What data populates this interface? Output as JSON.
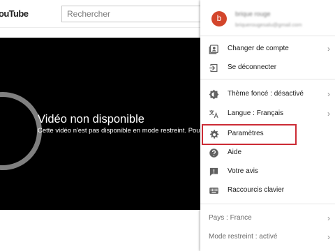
{
  "header": {
    "logo_text": "ouTube",
    "search_placeholder": "Rechercher"
  },
  "player": {
    "title": "Vidéo non disponible",
    "subtitle": "Cette vidéo n'est pas disponible en mode restreint. Pou"
  },
  "account": {
    "avatar_letter": "b",
    "name": "brique rouge",
    "email": "briquerougesalu@gmail.com",
    "avatar_color": "#d3462c"
  },
  "menu": {
    "switch_account": "Changer de compte",
    "sign_out": "Se déconnecter",
    "dark_theme": "Thème foncé : désactivé",
    "language": "Langue : Français",
    "settings": "Paramètres",
    "help": "Aide",
    "feedback": "Votre avis",
    "shortcuts": "Raccourcis clavier",
    "country": "Pays : France",
    "restricted_mode": "Mode restreint : activé",
    "chevron": "›"
  },
  "colors": {
    "highlight": "#cc2b35",
    "icon": "#606060"
  },
  "icons": [
    "account-box-icon",
    "sign-out-icon",
    "dark-theme-icon",
    "language-icon",
    "gear-icon",
    "help-icon",
    "feedback-icon",
    "keyboard-icon",
    "unavailable-icon"
  ]
}
